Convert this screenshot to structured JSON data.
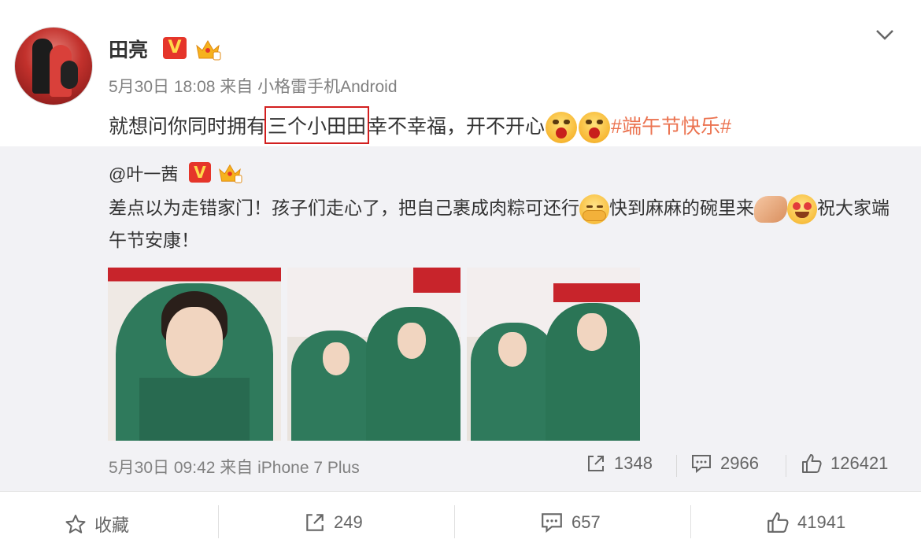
{
  "post": {
    "username": "田亮",
    "verified_badge": "V",
    "time": "5月30日 18:08",
    "from_label": "来自",
    "source": "小格雷手机Android",
    "text_before": "就想问你同时拥有",
    "text_highlight": "三个小田田",
    "text_after": "幸不幸福，开不开心",
    "topic": "#端午节快乐#"
  },
  "repost": {
    "username": "@叶一茜",
    "verified_badge": "V",
    "text_part1": "差点以为走错家门！孩子们走心了，把自己裹成肉粽可还行",
    "text_part2": "快到麻麻的碗里来",
    "text_part3": "祝大家端午节安康！",
    "time": "5月30日 09:42",
    "from_label": "来自",
    "source": "iPhone 7 Plus",
    "shares": "1348",
    "comments": "2966",
    "likes": "126421"
  },
  "actions": {
    "favorite_label": "收藏",
    "shares": "249",
    "comments": "657",
    "likes": "41941"
  },
  "colors": {
    "topic": "#eb7350",
    "highlight_border": "#d21f1f",
    "repost_bg": "#f2f2f5",
    "badge": "#e5352a"
  }
}
